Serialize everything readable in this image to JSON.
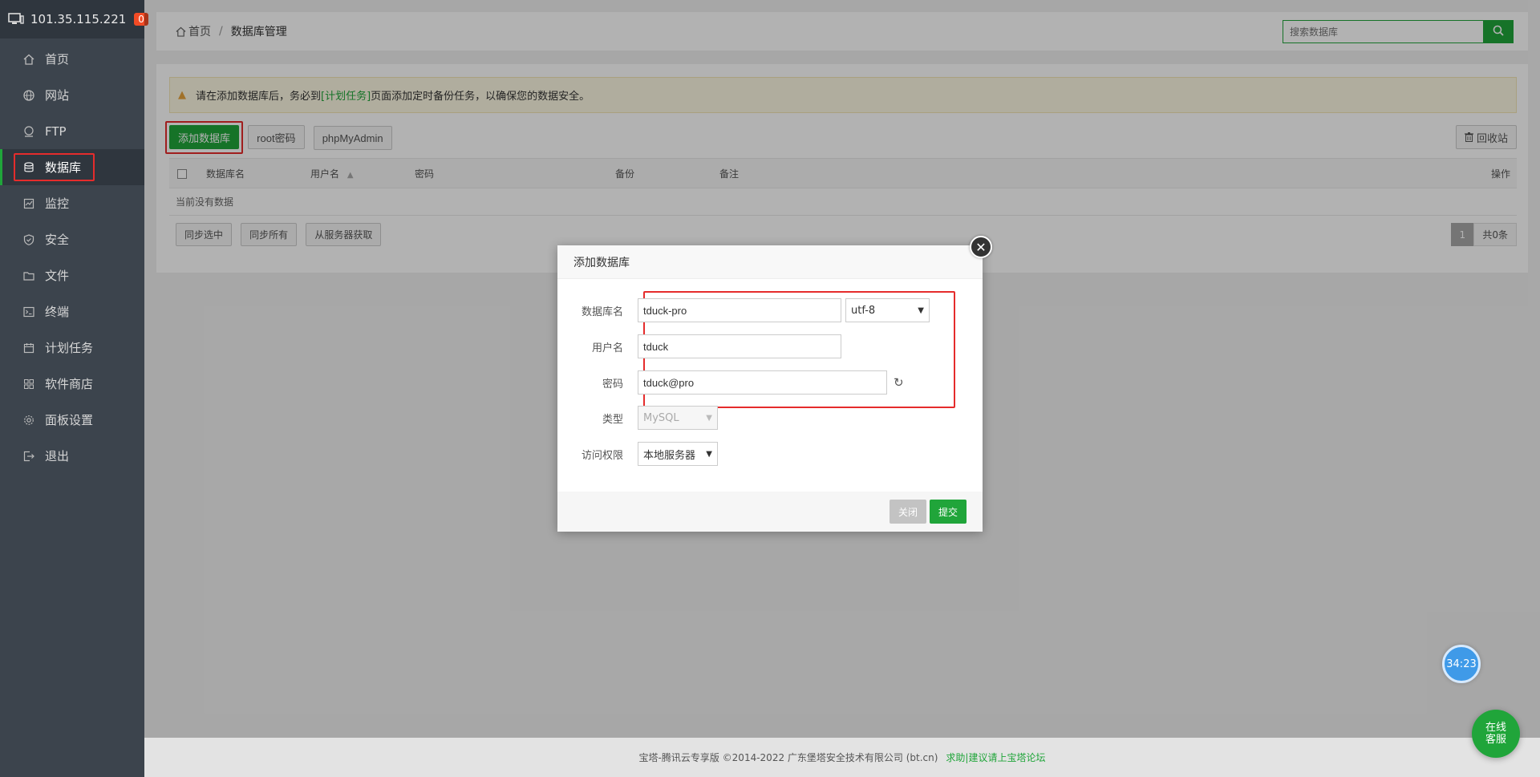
{
  "server": {
    "ip": "101.35.115.221",
    "badge": "0"
  },
  "sidebar": {
    "items": [
      {
        "label": "首页",
        "icon": "home-icon"
      },
      {
        "label": "网站",
        "icon": "globe-icon"
      },
      {
        "label": "FTP",
        "icon": "ftp-icon"
      },
      {
        "label": "数据库",
        "icon": "database-icon",
        "active": true
      },
      {
        "label": "监控",
        "icon": "monitor-icon"
      },
      {
        "label": "安全",
        "icon": "shield-icon"
      },
      {
        "label": "文件",
        "icon": "folder-icon"
      },
      {
        "label": "终端",
        "icon": "terminal-icon"
      },
      {
        "label": "计划任务",
        "icon": "calendar-icon"
      },
      {
        "label": "软件商店",
        "icon": "grid-icon"
      },
      {
        "label": "面板设置",
        "icon": "gear-icon"
      },
      {
        "label": "退出",
        "icon": "logout-icon"
      }
    ]
  },
  "breadcrumb": {
    "home": "首页",
    "sep": "/",
    "current": "数据库管理"
  },
  "search": {
    "placeholder": "搜索数据库"
  },
  "alert": {
    "prefix": "请在添加数据库后，务必到",
    "link": "[计划任务]",
    "suffix": "页面添加定时备份任务，以确保您的数据安全。"
  },
  "toolbar": {
    "add": "添加数据库",
    "root": "root密码",
    "phpmyadmin": "phpMyAdmin",
    "recycle": "回收站"
  },
  "table": {
    "headers": {
      "name": "数据库名",
      "user": "用户名",
      "password": "密码",
      "backup": "备份",
      "remark": "备注",
      "action": "操作"
    },
    "empty": "当前没有数据"
  },
  "bottom": {
    "sync_selected": "同步选中",
    "sync_all": "同步所有",
    "fetch_from_server": "从服务器获取",
    "page": "1",
    "total": "共0条"
  },
  "modal": {
    "title": "添加数据库",
    "fields": {
      "db_name_label": "数据库名",
      "db_name_value": "tduck-pro",
      "charset": "utf-8",
      "user_label": "用户名",
      "user_value": "tduck",
      "password_label": "密码",
      "password_value": "tduck@pro",
      "type_label": "类型",
      "type_value": "MySQL",
      "access_label": "访问权限",
      "access_value": "本地服务器"
    },
    "close_btn": "关闭",
    "submit_btn": "提交"
  },
  "footer": {
    "text": "宝塔-腾讯云专享版 ©2014-2022 广东堡塔安全技术有限公司 (bt.cn)",
    "link": "求助|建议请上宝塔论坛"
  },
  "timer": "34:23",
  "customer_service": {
    "line1": "在线",
    "line2": "客服"
  },
  "colors": {
    "accent": "#20a53a",
    "highlight": "#e52c2c",
    "sidebar": "#3c444d"
  }
}
